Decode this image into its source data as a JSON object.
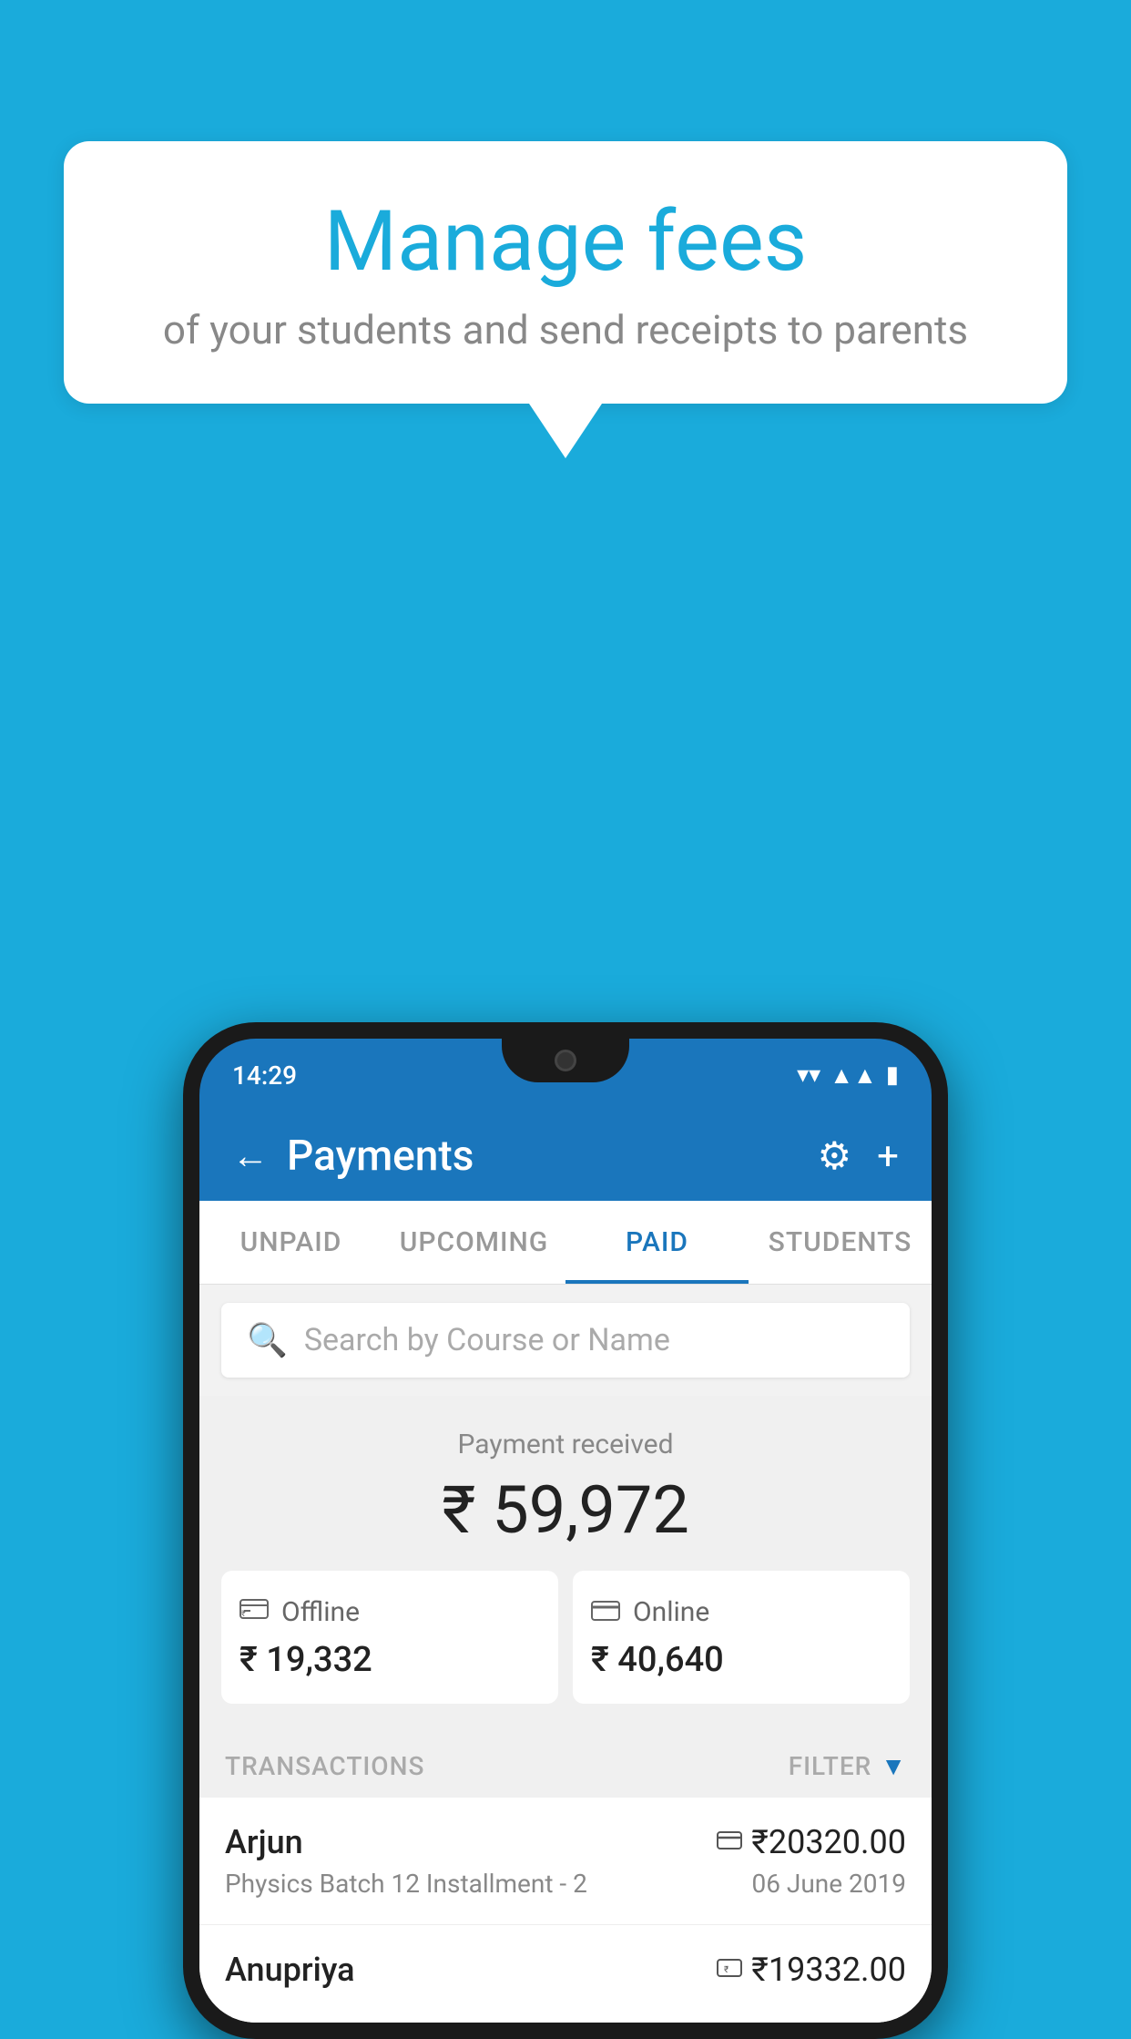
{
  "background_color": "#1AABDB",
  "speech_bubble": {
    "title": "Manage fees",
    "subtitle": "of your students and send receipts to parents"
  },
  "phone": {
    "status_bar": {
      "time": "14:29"
    },
    "header": {
      "back_label": "←",
      "title": "Payments",
      "gear_label": "⚙",
      "plus_label": "+"
    },
    "tabs": [
      {
        "label": "UNPAID",
        "active": false
      },
      {
        "label": "UPCOMING",
        "active": false
      },
      {
        "label": "PAID",
        "active": true
      },
      {
        "label": "STUDENTS",
        "active": false
      }
    ],
    "search": {
      "placeholder": "Search by Course or Name"
    },
    "payment_summary": {
      "label": "Payment received",
      "amount": "₹ 59,972",
      "offline": {
        "icon": "💳",
        "label": "Offline",
        "amount": "₹ 19,332"
      },
      "online": {
        "icon": "💳",
        "label": "Online",
        "amount": "₹ 40,640"
      }
    },
    "transactions": {
      "label": "TRANSACTIONS",
      "filter_label": "FILTER",
      "rows": [
        {
          "name": "Arjun",
          "description": "Physics Batch 12 Installment - 2",
          "amount": "₹20320.00",
          "date": "06 June 2019",
          "icon_type": "card"
        },
        {
          "name": "Anupriya",
          "description": "",
          "amount": "₹19332.00",
          "date": "",
          "icon_type": "cash"
        }
      ]
    }
  }
}
